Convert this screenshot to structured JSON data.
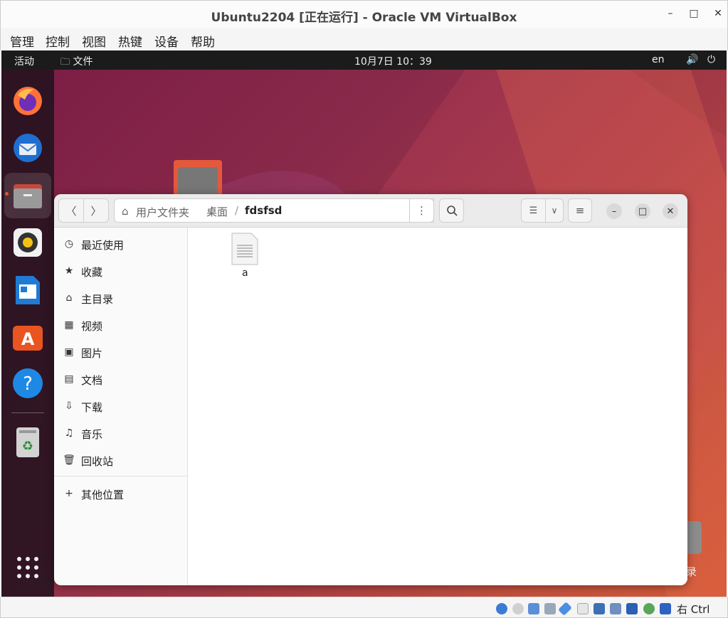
{
  "titlebar": {
    "title": "Ubuntu2204 [正在运行] - Oracle VM VirtualBox",
    "minimize": "–",
    "maximize": "□",
    "close": "✕"
  },
  "menubar": [
    "管理",
    "控制",
    "视图",
    "热键",
    "设备",
    "帮助"
  ],
  "topbar": {
    "activities": "活动",
    "app": "文件",
    "datetime": "10月7日  10：39",
    "lang": "en"
  },
  "dock": [
    "firefox-icon",
    "thunderbird-icon",
    "files-icon",
    "rhythmbox-icon",
    "libreoffice-writer-icon",
    "software-icon",
    "help-icon",
    "trash-icon",
    "app-grid-icon"
  ],
  "desktop": {
    "right_label": "录"
  },
  "files": {
    "breadcrumb": [
      "用户文件夹",
      "桌面",
      "fdsfsd"
    ],
    "sidebar": [
      {
        "icon": "recent-icon",
        "glyph": "◷",
        "label": "最近使用"
      },
      {
        "icon": "star-icon",
        "glyph": "★",
        "label": "收藏"
      },
      {
        "icon": "home-icon",
        "glyph": "⌂",
        "label": "主目录"
      },
      {
        "icon": "video-icon",
        "glyph": "▦",
        "label": "视频"
      },
      {
        "icon": "picture-icon",
        "glyph": "▣",
        "label": "图片"
      },
      {
        "icon": "document-icon",
        "glyph": "▤",
        "label": "文档"
      },
      {
        "icon": "download-icon",
        "glyph": "⇩",
        "label": "下载"
      },
      {
        "icon": "music-icon",
        "glyph": "♫",
        "label": "音乐"
      },
      {
        "icon": "trash-icon",
        "glyph": "🗑",
        "label": "回收站"
      }
    ],
    "other_locations": {
      "glyph": "+",
      "label": "其他位置"
    },
    "items": [
      {
        "name": "a",
        "type": "text-file"
      }
    ]
  },
  "statusbar": {
    "host_key": "右 Ctrl"
  }
}
